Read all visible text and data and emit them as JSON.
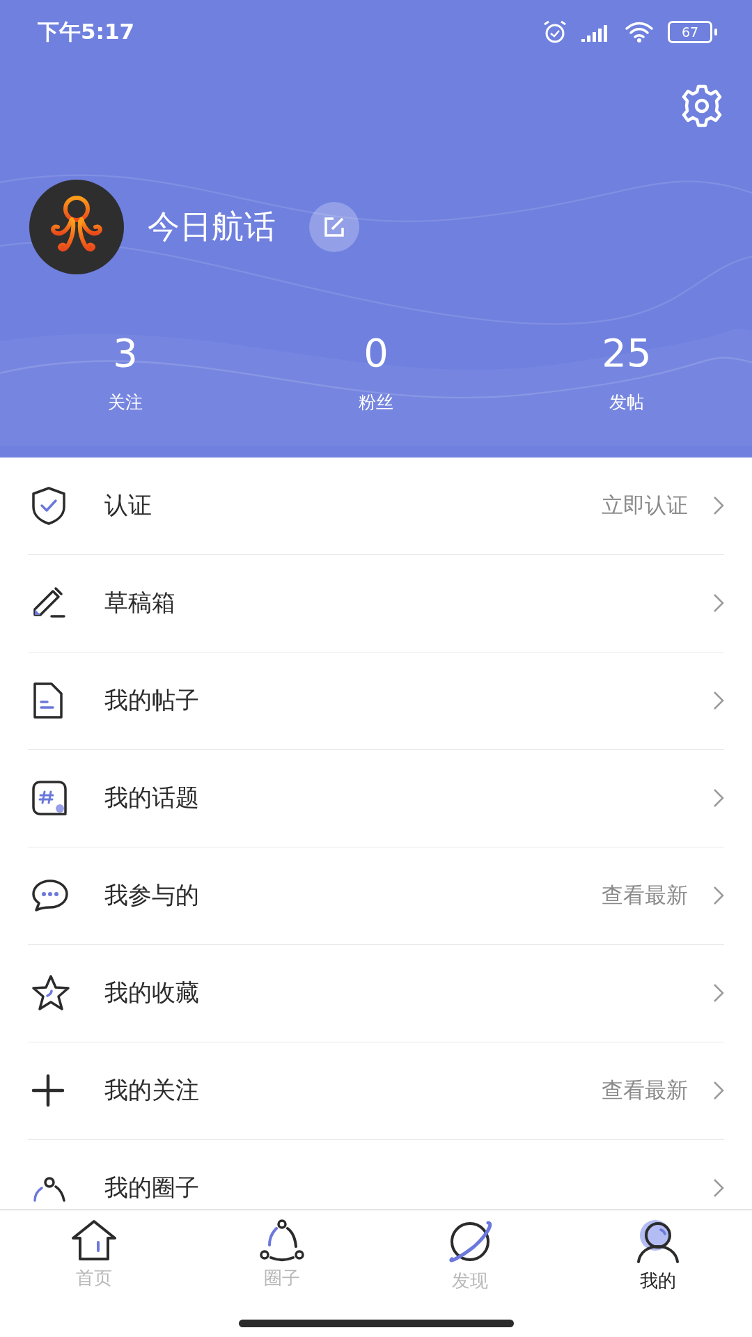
{
  "status_bar": {
    "time": "下午5:17",
    "battery": "67"
  },
  "profile": {
    "name": "今日航话"
  },
  "stats": [
    {
      "value": "3",
      "label": "关注"
    },
    {
      "value": "0",
      "label": "粉丝"
    },
    {
      "value": "25",
      "label": "发帖"
    }
  ],
  "menu": [
    {
      "label": "认证",
      "hint": "立即认证"
    },
    {
      "label": "草稿箱"
    },
    {
      "label": "我的帖子"
    },
    {
      "label": "我的话题"
    },
    {
      "label": "我参与的",
      "hint": "查看最新"
    },
    {
      "label": "我的收藏"
    },
    {
      "label": "我的关注",
      "hint": "查看最新"
    },
    {
      "label": "我的圈子"
    }
  ],
  "tab_bar": [
    {
      "label": "首页",
      "selected": false
    },
    {
      "label": "圈子",
      "selected": false
    },
    {
      "label": "发现",
      "selected": false
    },
    {
      "label": "我的",
      "selected": true
    }
  ]
}
